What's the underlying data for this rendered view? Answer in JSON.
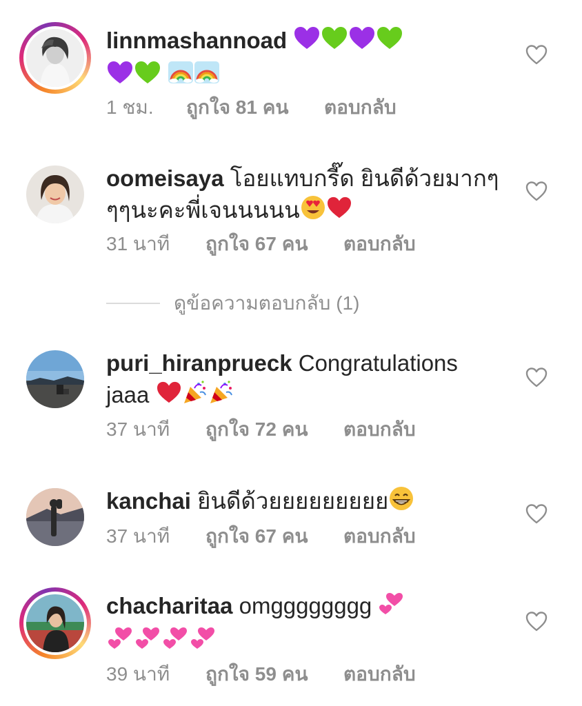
{
  "comments": [
    {
      "username": "linnmashannoad",
      "text": "",
      "time": "1 ชม.",
      "likes": "ถูกใจ 81 คน",
      "reply": "ตอบกลับ",
      "emojis_line1": [
        "purple-heart",
        "green-heart",
        "purple-heart",
        "green-heart"
      ],
      "emojis_line2": [
        "purple-heart",
        "green-heart",
        "rainbow",
        "rainbow"
      ]
    },
    {
      "username": "oomeisaya",
      "text": "โอยแทบกรี๊ด ยินดีด้วยมากๆ",
      "text2": "ๆๆนะคะพี่เจนนนนน",
      "time": "31 นาที",
      "likes": "ถูกใจ 67 คน",
      "reply": "ตอบกลับ",
      "emojis_line2": [
        "heart-eyes-face",
        "red-heart"
      ]
    },
    {
      "username": "puri_hiranprueck",
      "text": "Congratulations",
      "text2": "jaaa",
      "time": "37 นาที",
      "likes": "ถูกใจ 72 คน",
      "reply": "ตอบกลับ",
      "emojis_line2": [
        "red-heart",
        "party-popper",
        "party-popper"
      ]
    },
    {
      "username": "kanchai",
      "text": "ยินดีด้วยยยยยยยยย",
      "time": "37 นาที",
      "likes": "ถูกใจ 67 คน",
      "reply": "ตอบกลับ",
      "emojis_line1": [
        "grinning-face"
      ]
    },
    {
      "username": "chacharitaa",
      "text": "omgggggggg",
      "time": "39 นาที",
      "likes": "ถูกใจ 59 คน",
      "reply": "ตอบกลับ",
      "emojis_line1": [
        "two-hearts"
      ],
      "emojis_line2": [
        "two-hearts",
        "two-hearts",
        "two-hearts",
        "two-hearts"
      ]
    }
  ],
  "view_replies": "ดูข้อความตอบกลับ (1)",
  "colors": {
    "text": "#262626",
    "secondary": "#8e8e8e",
    "divider": "#dbdbdb"
  }
}
